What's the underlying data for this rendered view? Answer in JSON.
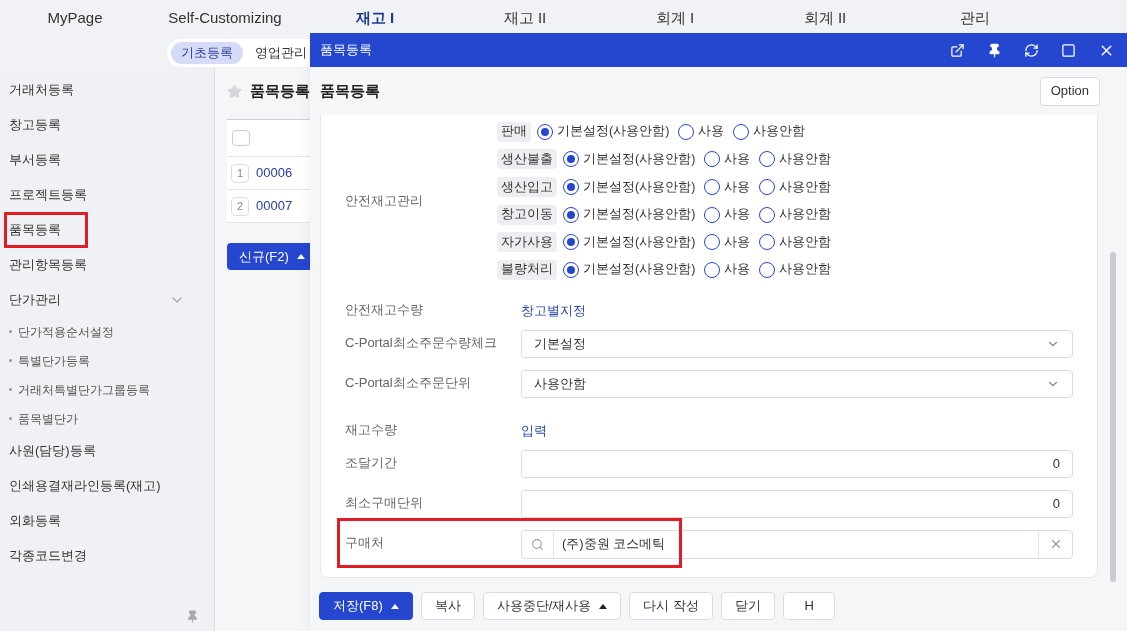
{
  "top_menu": [
    {
      "label": "MyPage",
      "selected": false
    },
    {
      "label": "Self-Customizing",
      "selected": false
    },
    {
      "label": "재고 I",
      "selected": true
    },
    {
      "label": "재고 II",
      "selected": false
    },
    {
      "label": "회계 I",
      "selected": false
    },
    {
      "label": "회계 II",
      "selected": false
    },
    {
      "label": "관리",
      "selected": false
    }
  ],
  "sub_tabs": [
    {
      "label": "기초등록",
      "selected": true
    },
    {
      "label": "영업관리",
      "selected": false
    }
  ],
  "sidebar": {
    "items": [
      {
        "label": "거래처등록",
        "highlighted": false
      },
      {
        "label": "창고등록",
        "highlighted": false
      },
      {
        "label": "부서등록",
        "highlighted": false
      },
      {
        "label": "프로젝트등록",
        "highlighted": false
      },
      {
        "label": "품목등록",
        "highlighted": true
      },
      {
        "label": "관리항목등록",
        "highlighted": false
      },
      {
        "label": "단가관리",
        "highlighted": false,
        "expanded": true,
        "children": [
          {
            "label": "단가적용순서설정"
          },
          {
            "label": "특별단가등록"
          },
          {
            "label": "거래처특별단가그룹등록"
          },
          {
            "label": "품목별단가"
          }
        ]
      },
      {
        "label": "사원(담당)등록",
        "highlighted": false
      },
      {
        "label": "인쇄용결재라인등록(재고)",
        "highlighted": false
      },
      {
        "label": "외화등록",
        "highlighted": false
      },
      {
        "label": "각종코드변경",
        "highlighted": false
      }
    ]
  },
  "page": {
    "title": "품목등록",
    "table": {
      "select_all_checked": false,
      "rows": [
        {
          "number": "1",
          "code": "00006"
        },
        {
          "number": "2",
          "code": "00007"
        }
      ]
    },
    "new_button": "신규(F2)"
  },
  "dialog": {
    "title": "품목등록",
    "heading": "품목등록",
    "option_button": "Option",
    "safety_stock": {
      "label": "안전재고관리",
      "rows": [
        {
          "tag": "판매",
          "options": [
            {
              "label": "기본설정(사용안함)",
              "selected": true
            },
            {
              "label": "사용",
              "selected": false
            },
            {
              "label": "사용안함",
              "selected": false
            }
          ]
        },
        {
          "tag": "생산불출",
          "options": [
            {
              "label": "기본설정(사용안함)",
              "selected": true
            },
            {
              "label": "사용",
              "selected": false
            },
            {
              "label": "사용안함",
              "selected": false
            }
          ]
        },
        {
          "tag": "생산입고",
          "options": [
            {
              "label": "기본설정(사용안함)",
              "selected": true
            },
            {
              "label": "사용",
              "selected": false
            },
            {
              "label": "사용안함",
              "selected": false
            }
          ]
        },
        {
          "tag": "창고이동",
          "options": [
            {
              "label": "기본설정(사용안함)",
              "selected": true
            },
            {
              "label": "사용",
              "selected": false
            },
            {
              "label": "사용안함",
              "selected": false
            }
          ]
        },
        {
          "tag": "자가사용",
          "options": [
            {
              "label": "기본설정(사용안함)",
              "selected": true
            },
            {
              "label": "사용",
              "selected": false
            },
            {
              "label": "사용안함",
              "selected": false
            }
          ]
        },
        {
          "tag": "불량처리",
          "options": [
            {
              "label": "기본설정(사용안함)",
              "selected": true
            },
            {
              "label": "사용",
              "selected": false
            },
            {
              "label": "사용안함",
              "selected": false
            }
          ]
        }
      ]
    },
    "fields": [
      {
        "kind": "link",
        "label": "안전재고수량",
        "value": "창고별지정"
      },
      {
        "kind": "select",
        "label": "C-Portal최소주문수량체크",
        "value": "기본설정"
      },
      {
        "kind": "select",
        "label": "C-Portal최소주문단위",
        "value": "사용안함"
      },
      {
        "kind": "link",
        "label": "재고수량",
        "value": "입력"
      },
      {
        "kind": "number",
        "label": "조달기간",
        "value": "0"
      },
      {
        "kind": "number",
        "label": "최소구매단위",
        "value": "0"
      },
      {
        "kind": "search",
        "label": "구매처",
        "value": "(주)중원 코스메틱",
        "highlighted": true
      }
    ],
    "footer_buttons": [
      {
        "label": "저장(F8)",
        "primary": true,
        "caret": true
      },
      {
        "label": "복사",
        "primary": false,
        "caret": false
      },
      {
        "label": "사용중단/재사용",
        "primary": false,
        "caret": true
      },
      {
        "label": "다시 작성",
        "primary": false,
        "caret": false
      },
      {
        "label": "닫기",
        "primary": false,
        "caret": false
      },
      {
        "label": "H",
        "primary": false,
        "caret": false
      }
    ]
  }
}
